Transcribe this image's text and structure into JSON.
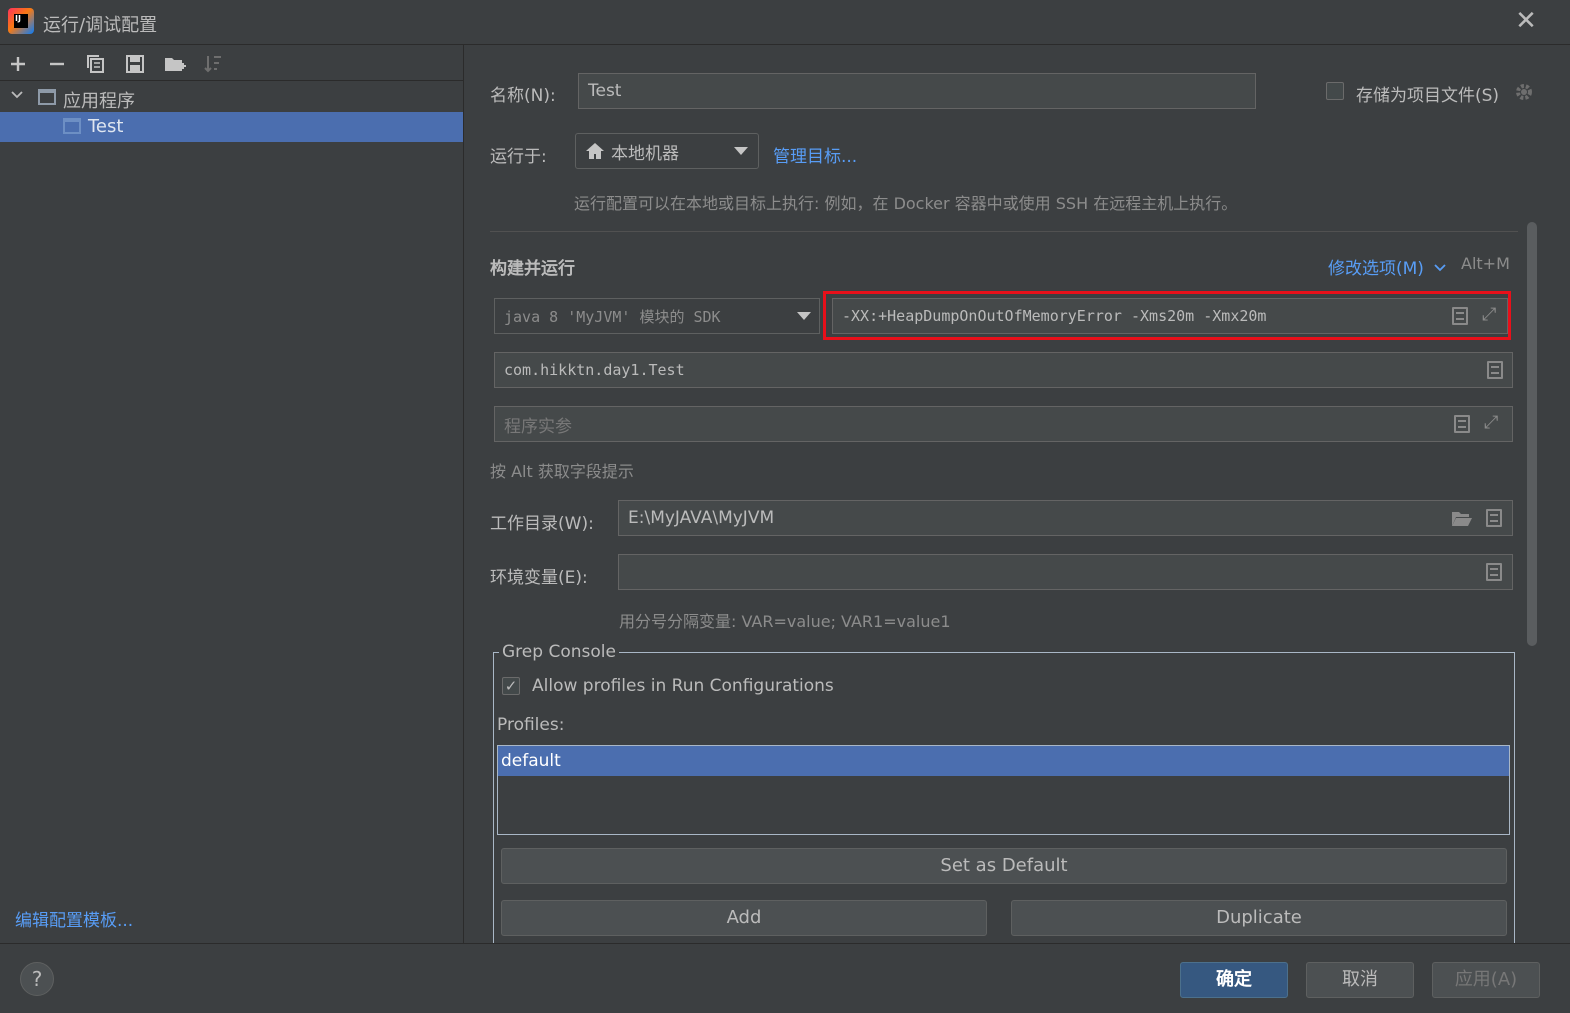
{
  "window": {
    "title": "运行/调试配置",
    "close_icon": "close-icon"
  },
  "toolbar": {
    "icons": [
      "plus-icon",
      "minus-icon",
      "copy-icon",
      "save-icon",
      "folder-add-icon",
      "sort-icon"
    ]
  },
  "tree": {
    "group_label": "应用程序",
    "child_label": "Test"
  },
  "left_footer": {
    "edit_templates": "编辑配置模板..."
  },
  "config": {
    "name_label": "名称(N):",
    "name_value": "Test",
    "store_as_project_file": "存储为项目文件(S)",
    "run_on_label": "运行于:",
    "run_on_value": "本地机器",
    "manage_targets": "管理目标...",
    "run_on_hint": "运行配置可以在本地或目标上执行: 例如，在 Docker 容器中或使用 SSH 在远程主机上执行。",
    "build_run_title": "构建并运行",
    "modify_options": "修改选项(M)",
    "modify_shortcut": "Alt+M",
    "sdk_value": "java 8 'MyJVM' 模块的 SDK",
    "vm_options_value": "-XX:+HeapDumpOnOutOfMemoryError -Xms20m -Xmx20m",
    "main_class_value": "com.hikktn.day1.Test",
    "program_args_placeholder": "程序实参",
    "alt_hint": "按 Alt 获取字段提示",
    "workdir_label": "工作目录(W):",
    "workdir_value": "E:\\MyJAVA\\MyJVM",
    "env_label": "环境变量(E):",
    "env_value": "",
    "env_hint": "用分号分隔变量: VAR=value; VAR1=value1"
  },
  "grep_console": {
    "title": "Grep Console",
    "allow_profiles": "Allow profiles in Run Configurations",
    "allow_profiles_checked": true,
    "profiles_label": "Profiles:",
    "profiles": [
      "default"
    ],
    "set_default": "Set as Default",
    "add": "Add",
    "duplicate": "Duplicate"
  },
  "footer": {
    "help": "?",
    "ok": "确定",
    "cancel": "取消",
    "apply": "应用(A)"
  }
}
